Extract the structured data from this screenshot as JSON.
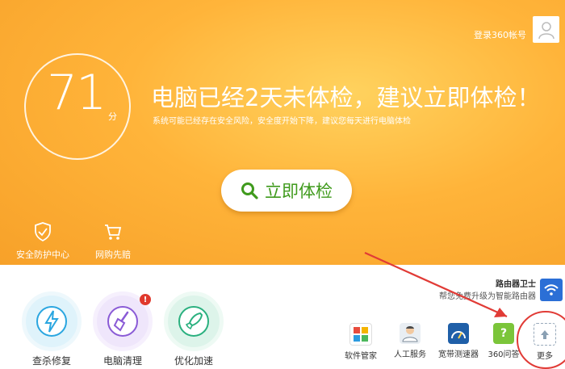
{
  "header": {
    "login_label": "登录360帐号"
  },
  "score": {
    "value": "71",
    "unit": "分"
  },
  "message": {
    "headline": "电脑已经2天未体检，建议立即体检！",
    "subline": "系统可能已经存在安全风险，安全度开始下降，建议您每天进行电脑体检"
  },
  "check_button": {
    "label": "立即体检"
  },
  "top_tools": [
    {
      "label": "安全防护中心",
      "icon": "shield-check-icon"
    },
    {
      "label": "网购先赔",
      "icon": "shopping-cart-icon"
    }
  ],
  "features": [
    {
      "label": "查杀修复",
      "icon": "lightning-icon",
      "color": "#2aa6e0"
    },
    {
      "label": "电脑清理",
      "icon": "broom-icon",
      "color": "#8a5bd6",
      "badge": "!"
    },
    {
      "label": "优化加速",
      "icon": "rocket-icon",
      "color": "#2ab07f"
    }
  ],
  "router": {
    "title": "路由器卫士",
    "subtitle": "帮您免费升级为智能路由器"
  },
  "apps": [
    {
      "label": "软件管家",
      "icon": "software-manager-icon"
    },
    {
      "label": "人工服务",
      "icon": "customer-service-icon"
    },
    {
      "label": "宽带测速器",
      "icon": "speed-test-icon"
    },
    {
      "label": "360问答",
      "icon": "qa-icon"
    },
    {
      "label": "更多",
      "icon": "more-arrow-icon"
    }
  ],
  "colors": {
    "accent_orange": "#f7a129",
    "check_green": "#3f9a1c",
    "annotation_red": "#e13b36"
  }
}
